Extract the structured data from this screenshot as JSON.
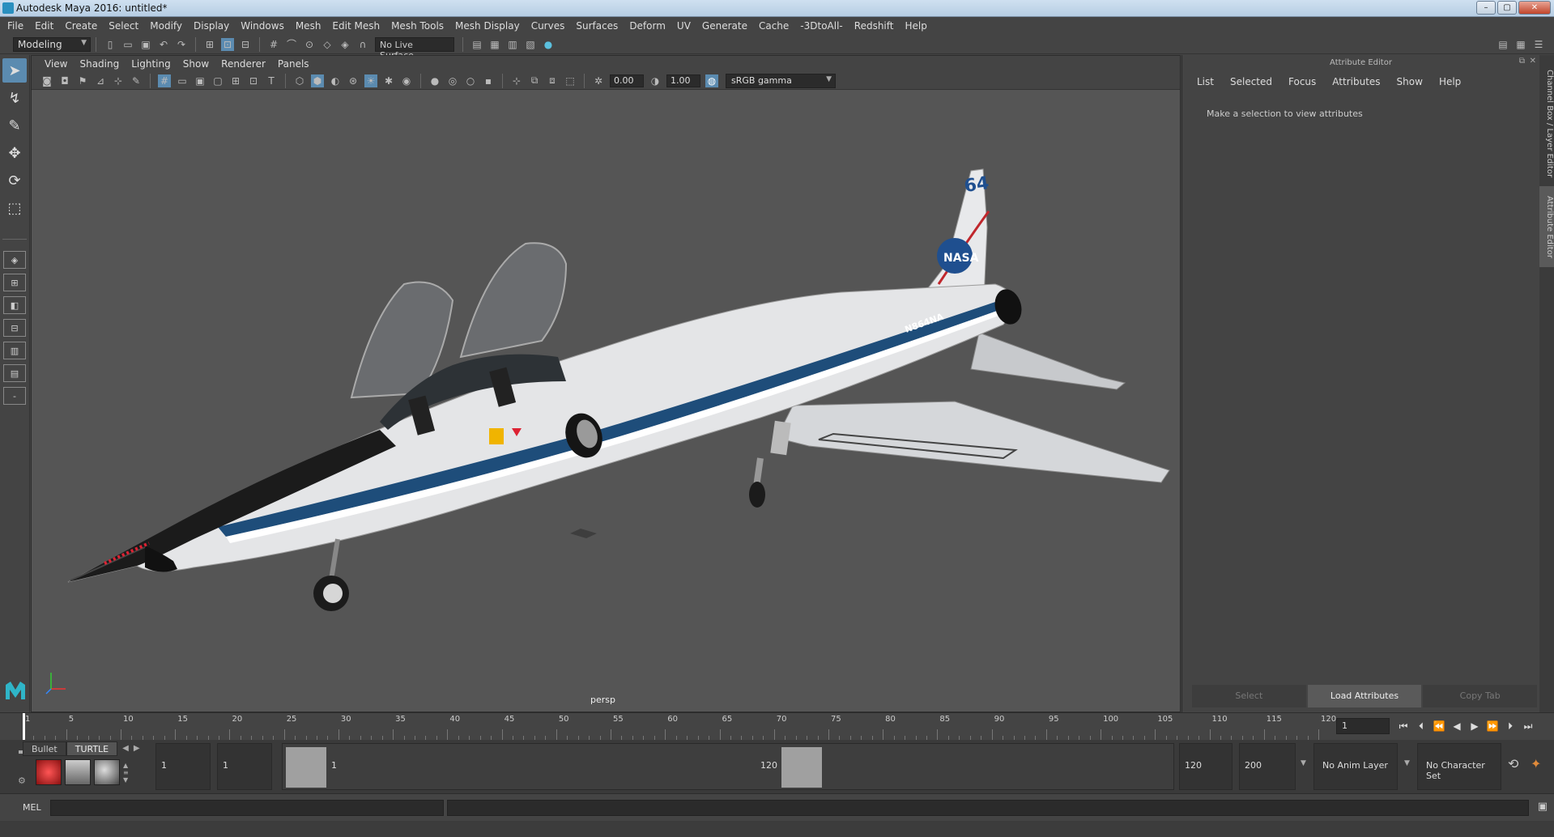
{
  "window": {
    "title": "Autodesk Maya 2016: untitled*",
    "buttons": [
      "–",
      "▢",
      "✕"
    ]
  },
  "menubar": [
    "File",
    "Edit",
    "Create",
    "Select",
    "Modify",
    "Display",
    "Windows",
    "Mesh",
    "Edit Mesh",
    "Mesh Tools",
    "Mesh Display",
    "Curves",
    "Surfaces",
    "Deform",
    "UV",
    "Generate",
    "Cache",
    "-3DtoAll-",
    "Redshift",
    "Help"
  ],
  "statusline": {
    "mode": "Modeling",
    "live_surface": "No Live Surface"
  },
  "viewport": {
    "menu": [
      "View",
      "Shading",
      "Lighting",
      "Show",
      "Renderer",
      "Panels"
    ],
    "exposure": "0.00",
    "gamma": "1.00",
    "color_space": "sRGB gamma",
    "camera_label": "persp",
    "aircraft": {
      "tail_number": "64",
      "registration": "N864NA",
      "logo": "NASA"
    }
  },
  "attribute_editor": {
    "title": "Attribute Editor",
    "menu": [
      "List",
      "Selected",
      "Focus",
      "Attributes",
      "Show",
      "Help"
    ],
    "message": "Make a selection to view attributes",
    "buttons": [
      "Select",
      "Load Attributes",
      "Copy Tab"
    ]
  },
  "side_tabs": [
    "Channel Box / Layer Editor",
    "Attribute Editor"
  ],
  "timeslider": {
    "ticks": [
      "1",
      "5",
      "10",
      "15",
      "20",
      "25",
      "30",
      "35",
      "40",
      "45",
      "50",
      "55",
      "60",
      "65",
      "70",
      "75",
      "80",
      "85",
      "90",
      "95",
      "100",
      "105",
      "110",
      "115",
      "120"
    ],
    "current_frame": "1"
  },
  "shelf": {
    "tabs": [
      "Bullet",
      "TURTLE"
    ]
  },
  "range": {
    "start": "1",
    "playback_start": "1",
    "range_start_label": "1",
    "range_end_label": "120",
    "playback_end": "120",
    "end": "200",
    "anim_layer": "No Anim Layer",
    "character_set": "No Character Set"
  },
  "commandline": {
    "label": "MEL"
  }
}
